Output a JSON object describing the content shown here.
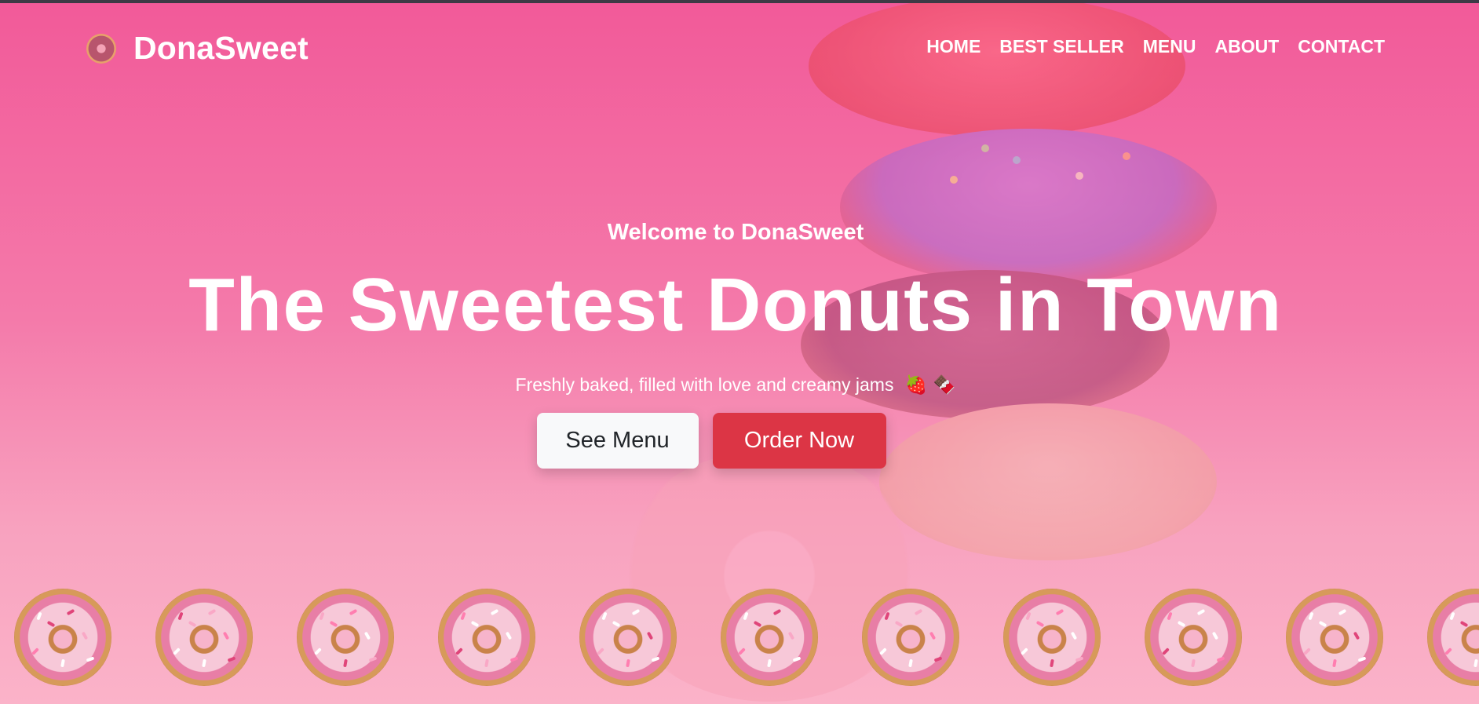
{
  "brand": {
    "name": "DonaSweet",
    "logo_icon": "donut-icon"
  },
  "nav": {
    "items": [
      "HOME",
      "BEST SELLER",
      "MENU",
      "ABOUT",
      "CONTACT"
    ]
  },
  "hero": {
    "welcome": "Welcome to DonaSweet",
    "headline": "The Sweetest Donuts in Town",
    "tagline": "Freshly baked, filled with love and creamy jams",
    "tagline_emojis": "🍓 🍫",
    "buttons": {
      "primary": "See Menu",
      "secondary": "Order Now"
    }
  },
  "colors": {
    "accent": "#dc3545",
    "background": "#f2609a",
    "light_button": "#f8f9fa"
  },
  "donut_row_count": 11
}
